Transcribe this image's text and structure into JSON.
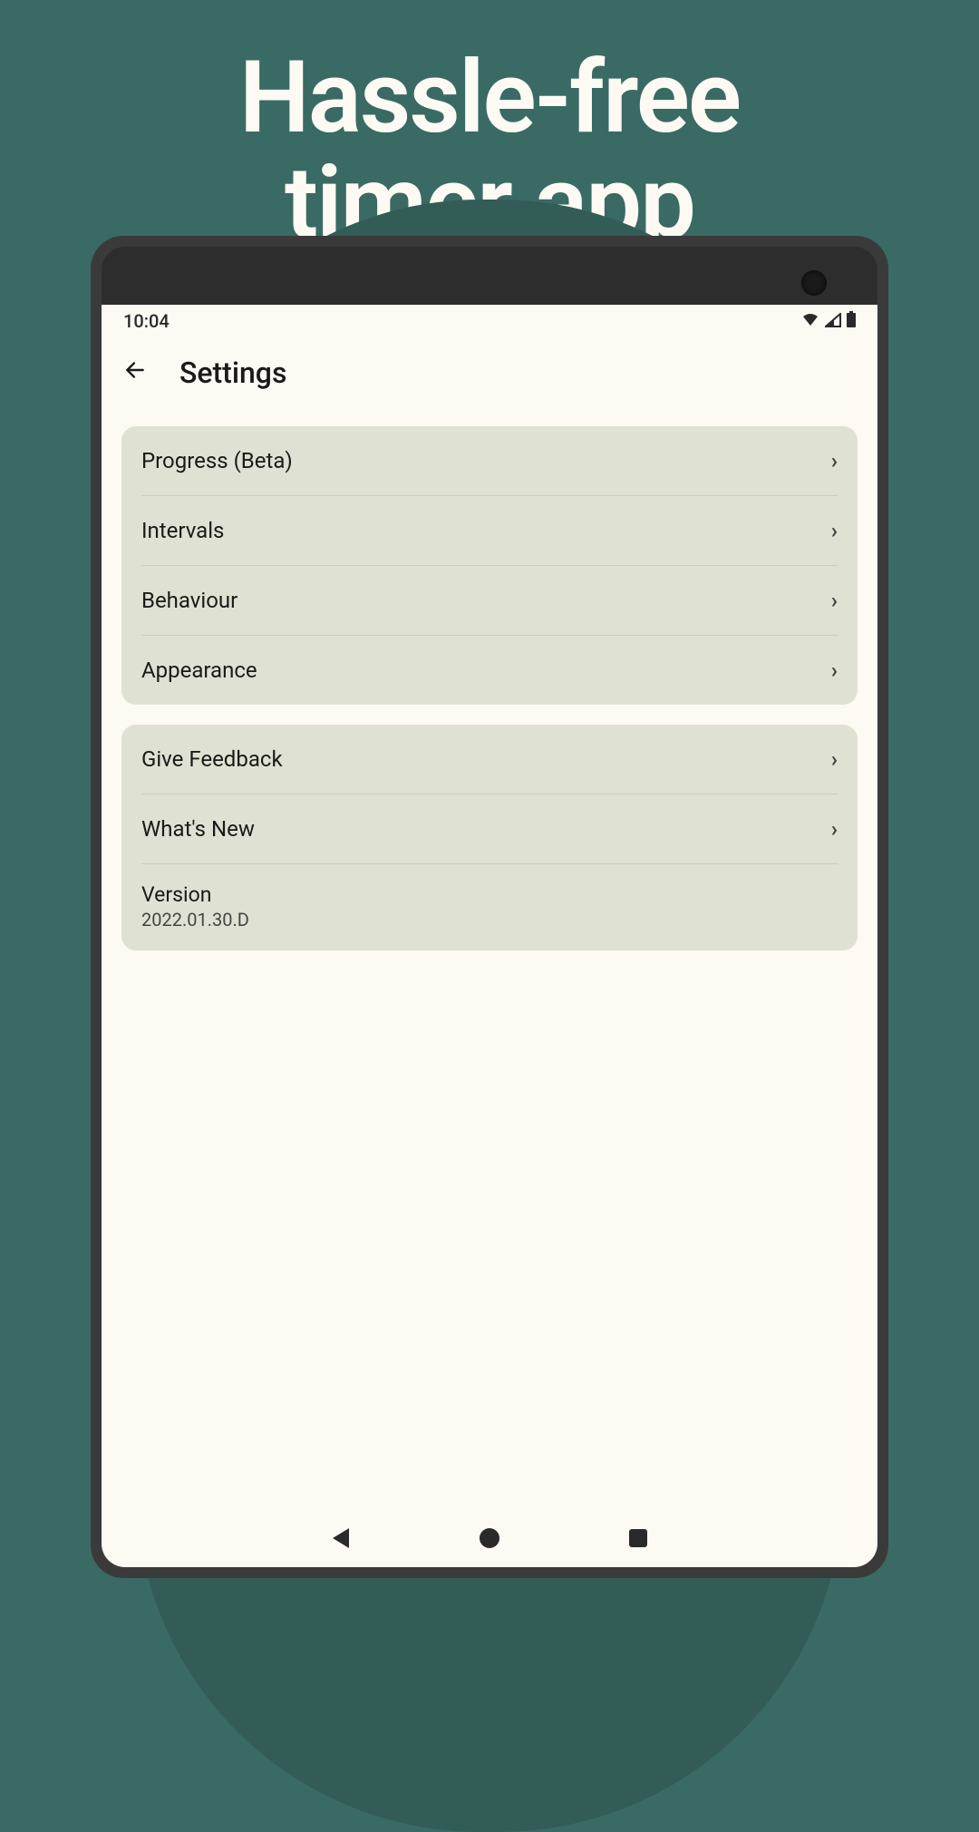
{
  "hero": {
    "line1": "Hassle-free",
    "line2": "timer app"
  },
  "status": {
    "time": "10:04"
  },
  "header": {
    "title": "Settings"
  },
  "group1": {
    "items": [
      {
        "label": "Progress (Beta)"
      },
      {
        "label": "Intervals"
      },
      {
        "label": "Behaviour"
      },
      {
        "label": "Appearance"
      }
    ]
  },
  "group2": {
    "items": [
      {
        "label": "Give Feedback"
      },
      {
        "label": "What's New"
      }
    ],
    "version_label": "Version",
    "version_value": "2022.01.30.D"
  }
}
